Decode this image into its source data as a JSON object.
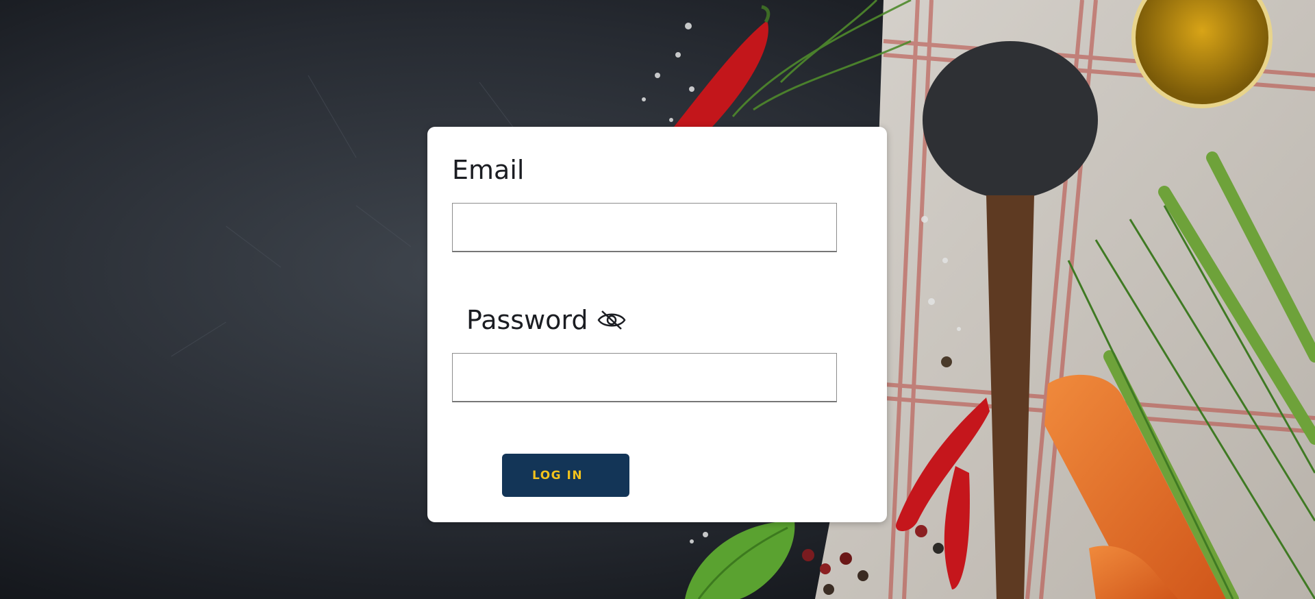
{
  "login_form": {
    "email_label": "Email",
    "email_value": "",
    "password_label": "Password",
    "password_value": "",
    "password_toggle_icon": "eye-off-icon",
    "login_button_label": "LOG IN"
  },
  "colors": {
    "card_background": "#ffffff",
    "button_background": "#133557",
    "button_text": "#f2c21c",
    "label_text": "#1b1d22"
  }
}
